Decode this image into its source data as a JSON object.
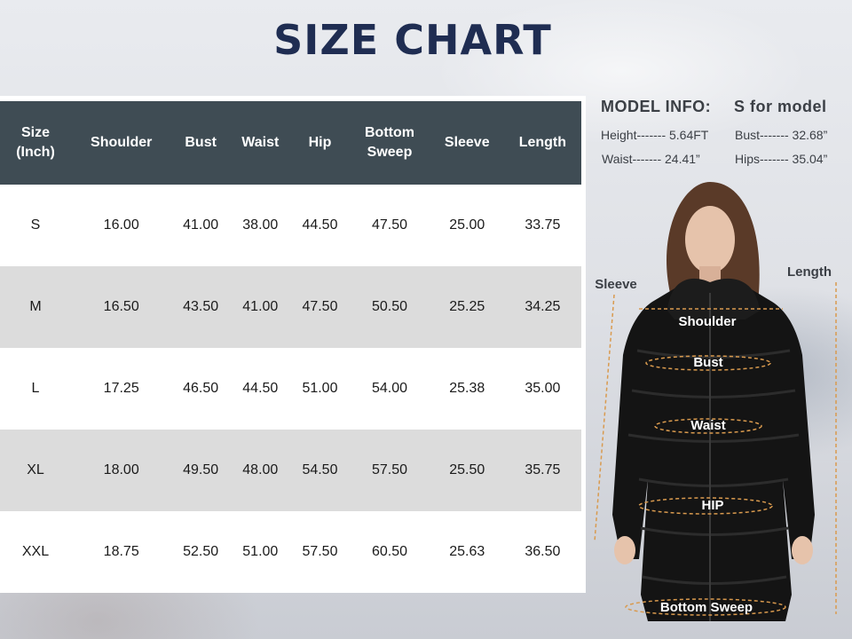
{
  "title": "SIZE CHART",
  "table": {
    "headers": [
      {
        "line1": "Size",
        "line2": "(Inch)"
      },
      {
        "line1": "Shoulder",
        "line2": ""
      },
      {
        "line1": "Bust",
        "line2": ""
      },
      {
        "line1": "Waist",
        "line2": ""
      },
      {
        "line1": "Hip",
        "line2": ""
      },
      {
        "line1": "Bottom",
        "line2": "Sweep"
      },
      {
        "line1": "Sleeve",
        "line2": ""
      },
      {
        "line1": "Length",
        "line2": ""
      }
    ],
    "rows": [
      [
        "S",
        "16.00",
        "41.00",
        "38.00",
        "44.50",
        "47.50",
        "25.00",
        "33.75"
      ],
      [
        "M",
        "16.50",
        "43.50",
        "41.00",
        "47.50",
        "50.50",
        "25.25",
        "34.25"
      ],
      [
        "L",
        "17.25",
        "46.50",
        "44.50",
        "51.00",
        "54.00",
        "25.38",
        "35.00"
      ],
      [
        "XL",
        "18.00",
        "49.50",
        "48.00",
        "54.50",
        "57.50",
        "25.50",
        "35.75"
      ],
      [
        "XXL",
        "18.75",
        "52.50",
        "51.00",
        "57.50",
        "60.50",
        "25.63",
        "36.50"
      ]
    ]
  },
  "model_info": {
    "heading_left": "MODEL INFO:",
    "heading_right": "S for model",
    "height": "Height------- 5.64FT",
    "bust": "Bust------- 32.68”",
    "waist": "Waist------- 24.41”",
    "hips": "Hips------- 35.04”"
  },
  "diagram_labels": {
    "sleeve": "Sleeve",
    "length": "Length",
    "shoulder": "Shoulder",
    "bust": "Bust",
    "waist": "Waist",
    "hip": "HIP",
    "bottom_sweep": "Bottom Sweep"
  },
  "colors": {
    "title": "#1f2d52",
    "header_bg": "#3f4c54",
    "stripe": "#dcdcdc",
    "guide": "#d99a4e",
    "coat": "#141414"
  }
}
